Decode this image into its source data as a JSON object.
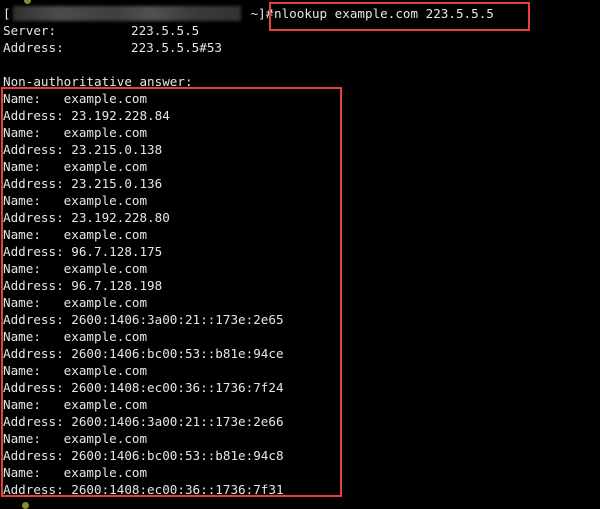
{
  "prompt": {
    "open_bracket": "[",
    "close": " ~]# ",
    "command": "nlookup example.com 223.5.5.5"
  },
  "server_info": {
    "server_label": "Server:",
    "server_value": "223.5.5.5",
    "address_label": "Address:",
    "address_value": "223.5.5.5#53"
  },
  "answer_header": "Non-authoritative answer:",
  "answers": [
    {
      "name_line": "Name:   example.com",
      "address_line": "Address: 23.192.228.84"
    },
    {
      "name_line": "Name:   example.com",
      "address_line": "Address: 23.215.0.138"
    },
    {
      "name_line": "Name:   example.com",
      "address_line": "Address: 23.215.0.136"
    },
    {
      "name_line": "Name:   example.com",
      "address_line": "Address: 23.192.228.80"
    },
    {
      "name_line": "Name:   example.com",
      "address_line": "Address: 96.7.128.175"
    },
    {
      "name_line": "Name:   example.com",
      "address_line": "Address: 96.7.128.198"
    },
    {
      "name_line": "Name:   example.com",
      "address_line": "Address: 2600:1406:3a00:21::173e:2e65"
    },
    {
      "name_line": "Name:   example.com",
      "address_line": "Address: 2600:1406:bc00:53::b81e:94ce"
    },
    {
      "name_line": "Name:   example.com",
      "address_line": "Address: 2600:1408:ec00:36::1736:7f24"
    },
    {
      "name_line": "Name:   example.com",
      "address_line": "Address: 2600:1406:3a00:21::173e:2e66"
    },
    {
      "name_line": "Name:   example.com",
      "address_line": "Address: 2600:1406:bc00:53::b81e:94c8"
    },
    {
      "name_line": "Name:   example.com",
      "address_line": "Address: 2600:1408:ec00:36::1736:7f31"
    }
  ],
  "colors": {
    "background": "#000000",
    "text": "#e6e6e6",
    "highlight": "#e8403c"
  }
}
